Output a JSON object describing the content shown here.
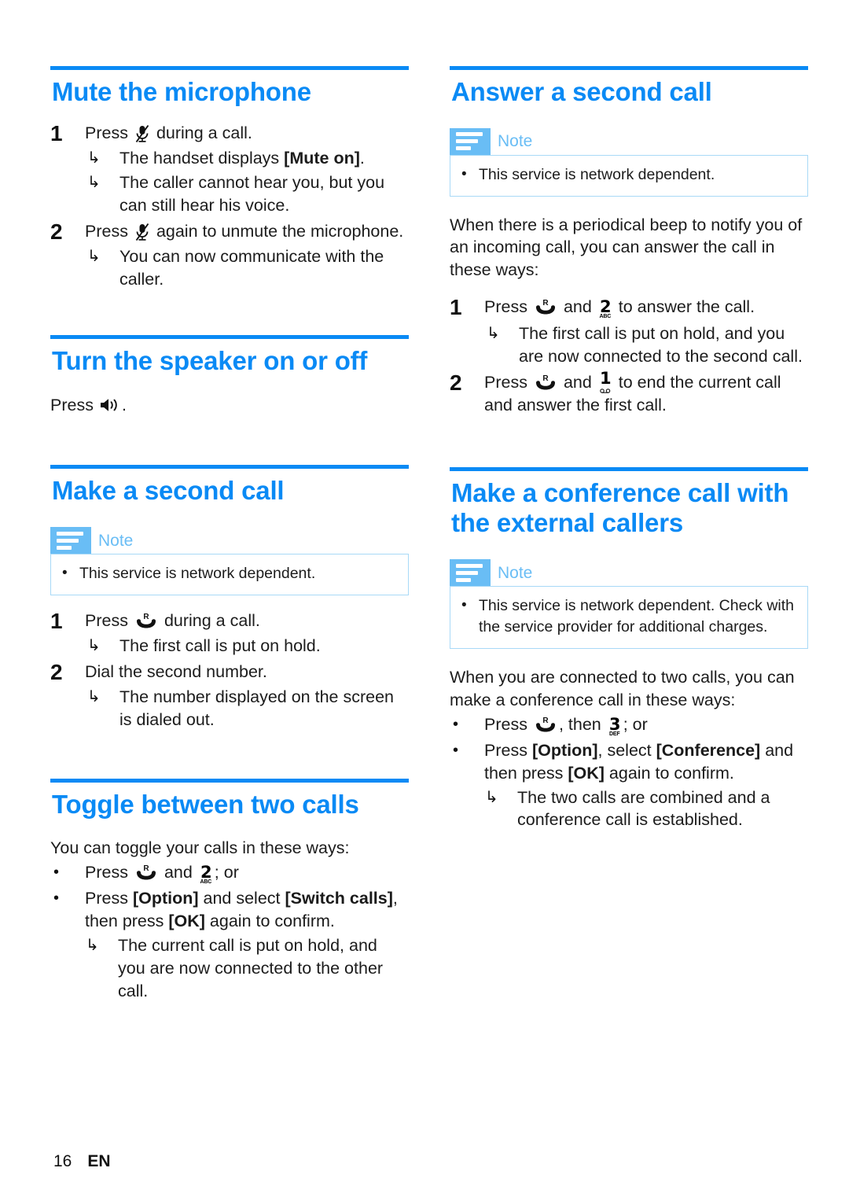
{
  "page": {
    "footer_page": "16",
    "footer_lang": "EN"
  },
  "colors": {
    "accent_blue": "#0a8af5",
    "note_blue": "#69bdf5",
    "note_border": "#a8d9f7",
    "body_text": "#1c1c1c"
  },
  "note_label": "Note",
  "left_column": {
    "mute": {
      "heading": "Mute the microphone",
      "steps": [
        {
          "num": "1",
          "text_before": "Press",
          "icon": "mute-microphone-icon",
          "text_after": "during a call.",
          "results": [
            {
              "pre": "The handset displays ",
              "bold": "[Mute on]",
              "post": "."
            },
            {
              "pre": "The caller cannot hear you, but you can still hear his voice.",
              "bold": "",
              "post": ""
            }
          ]
        },
        {
          "num": "2",
          "text_before": "Press",
          "icon": "mute-microphone-icon",
          "text_after": "again to unmute the microphone.",
          "results": [
            {
              "pre": "You can now communicate with the caller.",
              "bold": "",
              "post": ""
            }
          ]
        }
      ]
    },
    "speaker": {
      "heading": "Turn the speaker on or off",
      "press_label": "Press",
      "icon": "speaker-icon",
      "trailing": "."
    },
    "second_call": {
      "heading": "Make a second call",
      "note_items": [
        "This service is network dependent."
      ],
      "steps": [
        {
          "num": "1",
          "text_before": "Press",
          "icon": "recall-r-icon",
          "text_after": "during a call.",
          "results": [
            {
              "pre": "The first call is put on hold.",
              "bold": "",
              "post": ""
            }
          ]
        },
        {
          "num": "2",
          "text_before": "Dial the second number.",
          "icon": "",
          "text_after": "",
          "results": [
            {
              "pre": "The number displayed on the screen is dialed out.",
              "bold": "",
              "post": ""
            }
          ]
        }
      ]
    },
    "toggle": {
      "heading": "Toggle between two calls",
      "intro": "You can toggle your calls in these ways:",
      "bullet1": {
        "pre": "Press",
        "icon1": "recall-r-icon",
        "mid": "and",
        "icon2": "key-2-abc-icon",
        "post": "; or"
      },
      "bullet2": {
        "pre": "Press ",
        "b1": "[Option]",
        "mid1": " and select ",
        "b2": "[Switch calls]",
        "mid2": ", then press ",
        "b3": "[OK]",
        "post": " again to confirm.",
        "result": "The current call is put on hold, and you are now connected to the other call."
      }
    }
  },
  "right_column": {
    "answer_second": {
      "heading": "Answer a second call",
      "note_items": [
        "This service is network dependent."
      ],
      "intro": "When there is a periodical beep to notify you of an incoming call, you can answer the call in these ways:",
      "steps": [
        {
          "num": "1",
          "text_before": "Press",
          "icon1": "recall-r-icon",
          "mid": "and",
          "icon2": "key-2-abc-icon",
          "text_after": "to answer the call.",
          "results": [
            {
              "pre": "The first call is put on hold, and you are now connected to the second call.",
              "bold": "",
              "post": ""
            }
          ]
        },
        {
          "num": "2",
          "text_before": "Press",
          "icon1": "recall-r-icon",
          "mid": "and",
          "icon2": "key-1-voicemail-icon",
          "text_after": "to end the current call and answer the first call.",
          "results": []
        }
      ]
    },
    "conference": {
      "heading": "Make a conference call with the external callers",
      "note_items": [
        "This service is network dependent. Check with the service provider for additional charges."
      ],
      "intro": "When you are connected to two calls, you can make a conference call in these ways:",
      "bullet1": {
        "pre": "Press",
        "icon1": "recall-r-icon",
        "mid": ", then",
        "icon2": "key-3-def-icon",
        "post": "; or"
      },
      "bullet2": {
        "pre": "Press ",
        "b1": "[Option]",
        "mid1": ", select ",
        "b2": "[Conference]",
        "mid2": " and then press ",
        "b3": "[OK]",
        "post": " again to confirm.",
        "result": "The two calls are combined and a conference call is established."
      }
    }
  },
  "glyphs": {
    "arrow": "↳",
    "bullet": "•",
    "key2_digit": "2",
    "key2_sub": "ABC",
    "key3_digit": "3",
    "key3_sub": "DEF",
    "key1_digit": "1"
  }
}
